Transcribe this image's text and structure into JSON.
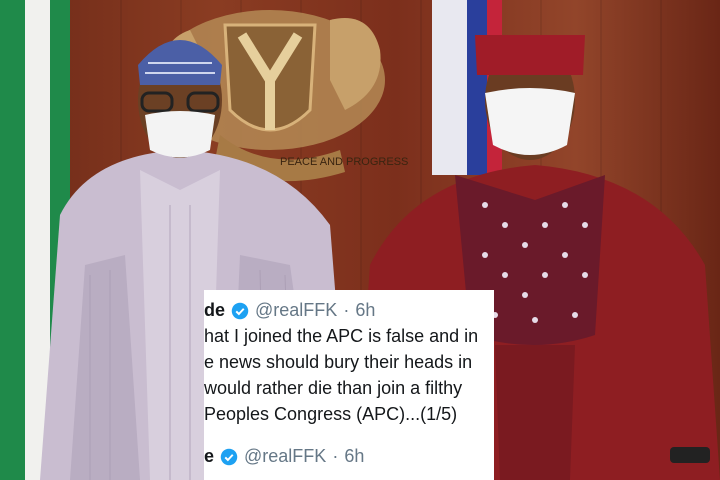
{
  "tweet_1": {
    "name_fragment": "de",
    "handle": "@realFFK",
    "separator": "·",
    "time": "6h",
    "lines": [
      "hat I joined the APC is false and in",
      "e news should bury their heads in",
      "would rather die than join a filthy",
      "Peoples Congress (APC)...(1/5)"
    ]
  },
  "tweet_2": {
    "name_fragment": "e",
    "handle": "@realFFK",
    "separator": "·",
    "time": "6h"
  },
  "crest": {
    "motto_fragment": "PEACE AND PROGRESS"
  },
  "colors": {
    "verified_blue": "#1da1f2",
    "flag_green": "#1f8a4a",
    "agbada_left": "#c9bdd0",
    "agbada_right": "#8e1e22"
  }
}
